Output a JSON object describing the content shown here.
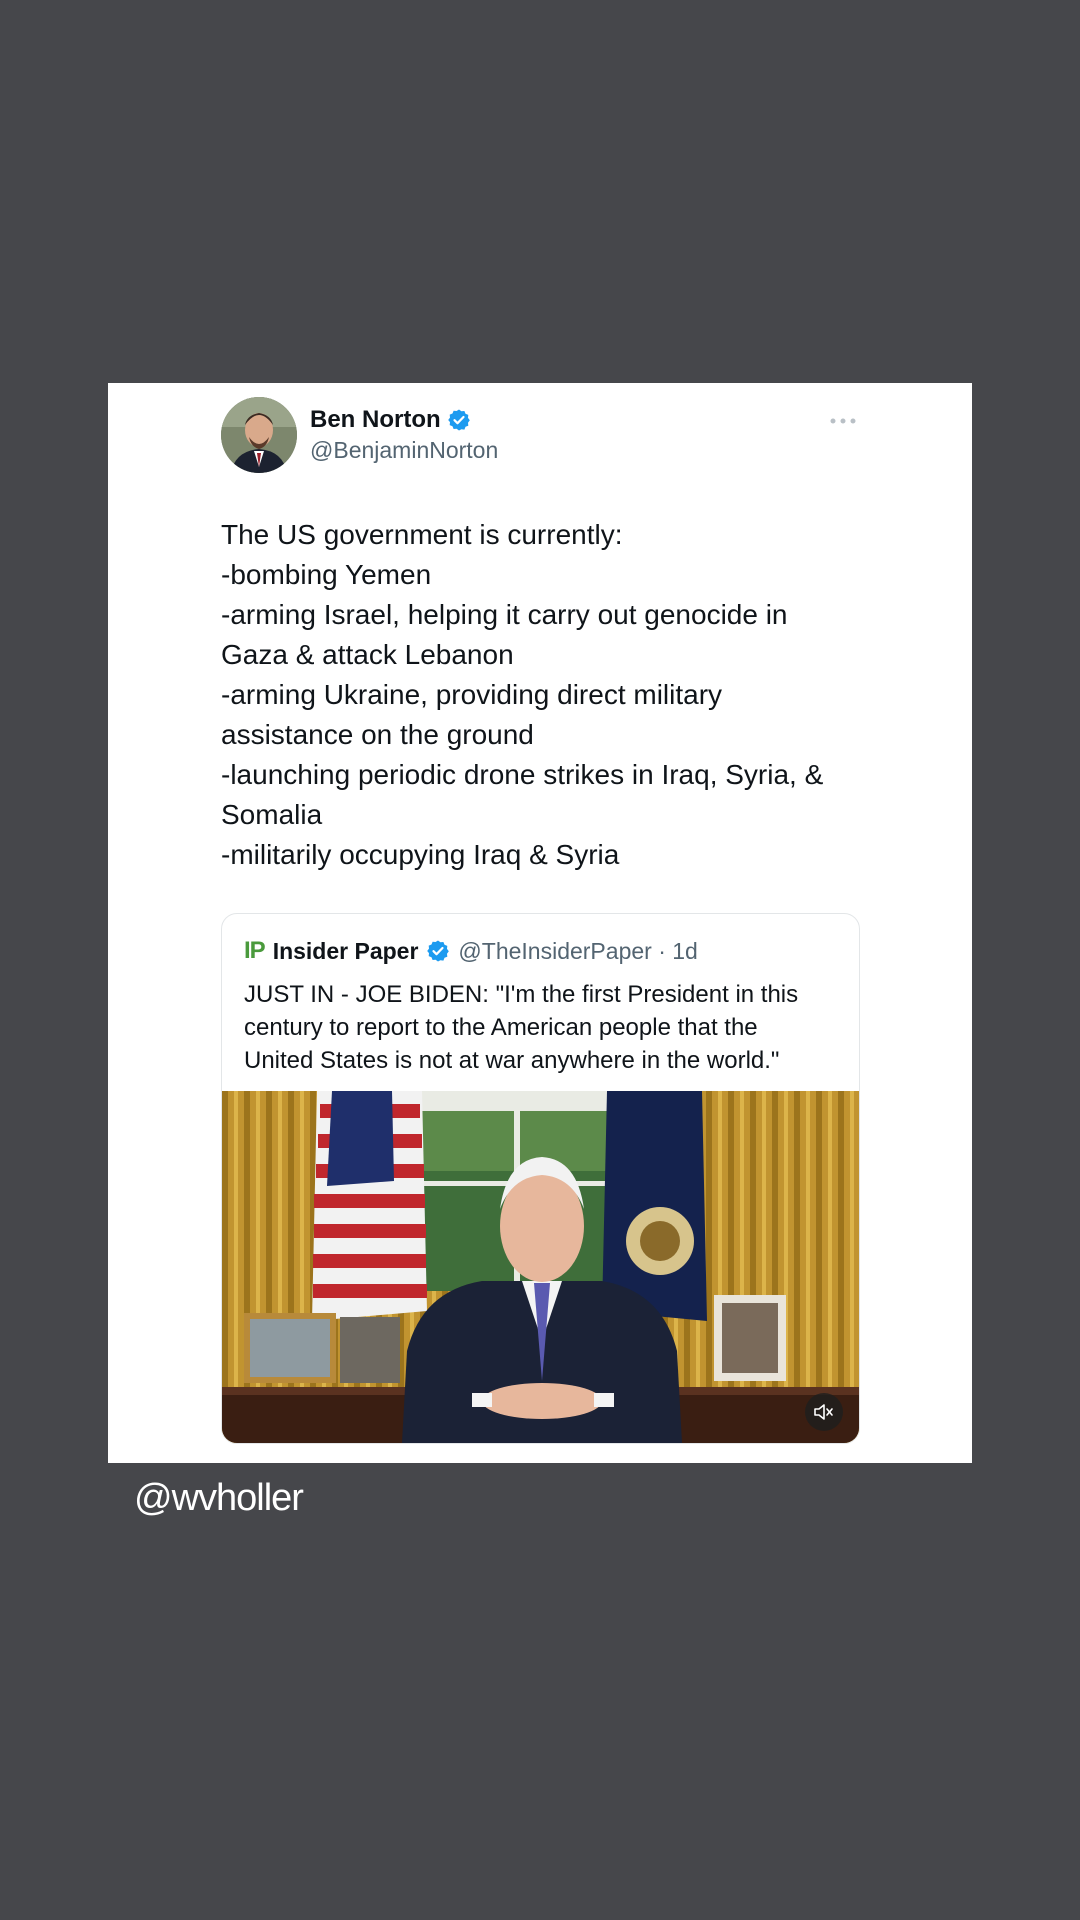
{
  "tweet": {
    "author_name": "Ben Norton",
    "author_handle": "@BenjaminNorton",
    "avatar_icon": "avatar-photo",
    "verified_icon": "verified-badge-icon",
    "more_icon": "more-options-icon",
    "text_lines": [
      "The US government is currently:",
      "-bombing Yemen",
      "-arming Israel, helping it carry out genocide in",
      "Gaza & attack Lebanon",
      "-arming Ukraine, providing direct military",
      "assistance on the ground",
      "-launching periodic drone strikes in Iraq, Syria, &",
      "Somalia",
      "-militarily occupying Iraq & Syria"
    ]
  },
  "quote": {
    "logo_text": "IP",
    "name": "Insider Paper",
    "handle_time": "@TheInsiderPaper · 1d",
    "text_lines": [
      "JUST IN - JOE BIDEN: \"I'm the first President in this",
      "century to report to the American people that the",
      "United States is not at war anywhere in the world.\""
    ],
    "media_icon": "video-thumbnail",
    "mute_icon": "mute-icon"
  },
  "watermark": "@wvholler",
  "colors": {
    "background": "#46474b",
    "card": "#ffffff",
    "verified": "#1d9bf0",
    "text": "#0f1419",
    "secondary_text": "#536471"
  }
}
